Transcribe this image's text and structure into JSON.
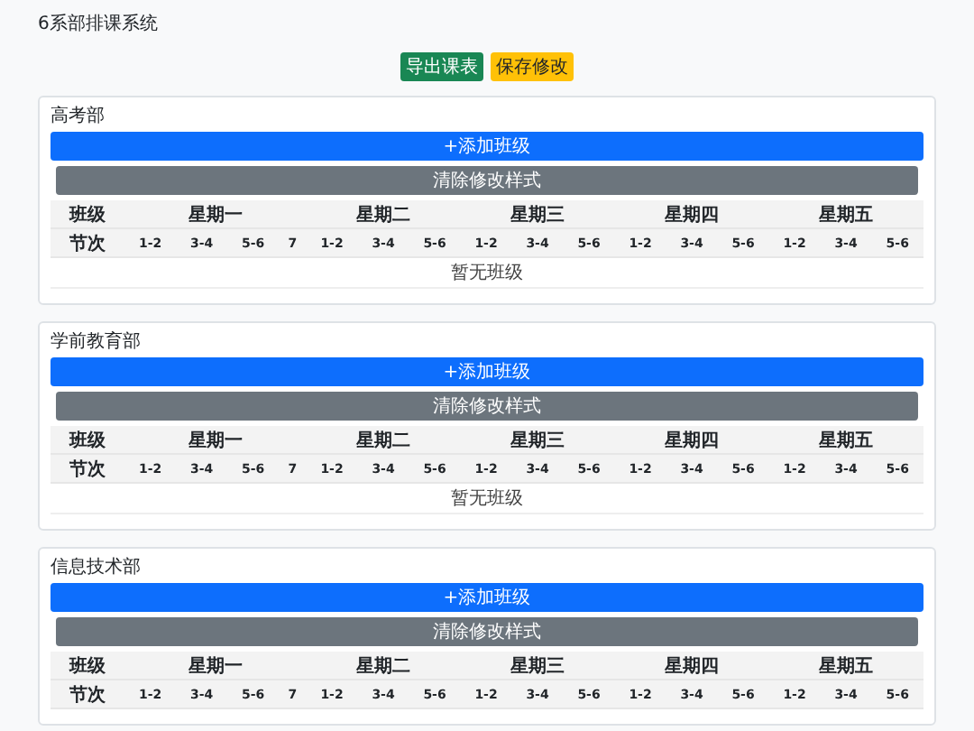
{
  "title": "6系部排课系统",
  "toolbar": [
    {
      "kind": "success",
      "label": "导出课表"
    },
    {
      "kind": "warning",
      "label": "保存修改"
    }
  ],
  "departments": [
    {
      "name": "高考部",
      "add_button": "+添加班级",
      "clear_button": "清除修改样式",
      "class_label": "班级",
      "period_label": "节次",
      "days": [
        {
          "label": "星期一",
          "periods": [
            "1-2",
            "3-4",
            "5-6",
            "7"
          ]
        },
        {
          "label": "星期二",
          "periods": [
            "1-2",
            "3-4",
            "5-6"
          ]
        },
        {
          "label": "星期三",
          "periods": [
            "1-2",
            "3-4",
            "5-6"
          ]
        },
        {
          "label": "星期四",
          "periods": [
            "1-2",
            "3-4",
            "5-6"
          ]
        },
        {
          "label": "星期五",
          "periods": [
            "1-2",
            "3-4",
            "5-6"
          ]
        }
      ],
      "empty_text": "暂无班级"
    },
    {
      "name": "学前教育部",
      "add_button": "+添加班级",
      "clear_button": "清除修改样式",
      "class_label": "班级",
      "period_label": "节次",
      "days": [
        {
          "label": "星期一",
          "periods": [
            "1-2",
            "3-4",
            "5-6",
            "7"
          ]
        },
        {
          "label": "星期二",
          "periods": [
            "1-2",
            "3-4",
            "5-6"
          ]
        },
        {
          "label": "星期三",
          "periods": [
            "1-2",
            "3-4",
            "5-6"
          ]
        },
        {
          "label": "星期四",
          "periods": [
            "1-2",
            "3-4",
            "5-6"
          ]
        },
        {
          "label": "星期五",
          "periods": [
            "1-2",
            "3-4",
            "5-6"
          ]
        }
      ],
      "empty_text": "暂无班级"
    },
    {
      "name": "信息技术部",
      "add_button": "+添加班级",
      "clear_button": "清除修改样式",
      "class_label": "班级",
      "period_label": "节次",
      "days": [
        {
          "label": "星期一",
          "periods": [
            "1-2",
            "3-4",
            "5-6",
            "7"
          ]
        },
        {
          "label": "星期二",
          "periods": [
            "1-2",
            "3-4",
            "5-6"
          ]
        },
        {
          "label": "星期三",
          "periods": [
            "1-2",
            "3-4",
            "5-6"
          ]
        },
        {
          "label": "星期四",
          "periods": [
            "1-2",
            "3-4",
            "5-6"
          ]
        },
        {
          "label": "星期五",
          "periods": [
            "1-2",
            "3-4",
            "5-6"
          ]
        }
      ]
    }
  ]
}
